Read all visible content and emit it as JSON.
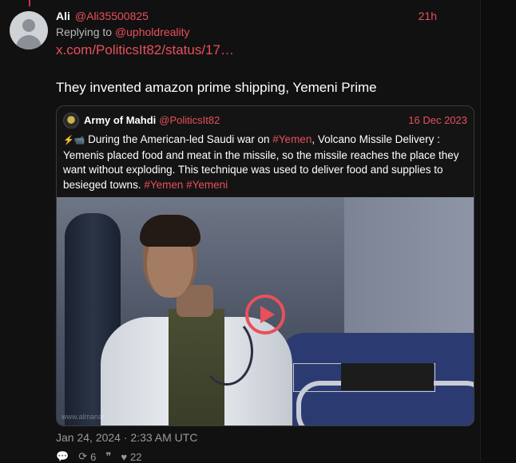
{
  "post": {
    "author_name": "Ali",
    "author_handle": "@Ali35500825",
    "time_ago": "21h",
    "replying_prefix": "Replying to ",
    "replying_to": "@upholdreality",
    "link": "x.com/PoliticsIt82/status/17…",
    "text": "They invented amazon prime shipping, Yemeni Prime",
    "timestamp": "Jan 24, 2024 · 2:33 AM UTC",
    "stats": {
      "retweets": "6",
      "likes": "22"
    }
  },
  "quote": {
    "author_name": "Army of Mahdi",
    "author_handle": "@PoliticsIt82",
    "date": "16 Dec 2023",
    "emoji": "⚡📹",
    "text_a": " During the American-led Saudi war on ",
    "hashtag_a": "#Yemen",
    "text_b": ", Volcano Missile Delivery : Yemenis placed food and meat in the missile, so the missile reaches the place they want without exploding. This technique was used to deliver food and supplies to besieged towns. ",
    "hashtag_b": "#Yemen",
    "hashtag_c": "#Yemeni",
    "video_watermark": "www.almanar"
  },
  "icons": {
    "reply": "comment-icon",
    "retweet": "retweet-icon",
    "quote": "quote-icon",
    "like": "heart-icon",
    "play": "play-icon"
  },
  "colors": {
    "accent": "#e8505b",
    "background": "#111111",
    "muted": "#9a9a9a"
  }
}
